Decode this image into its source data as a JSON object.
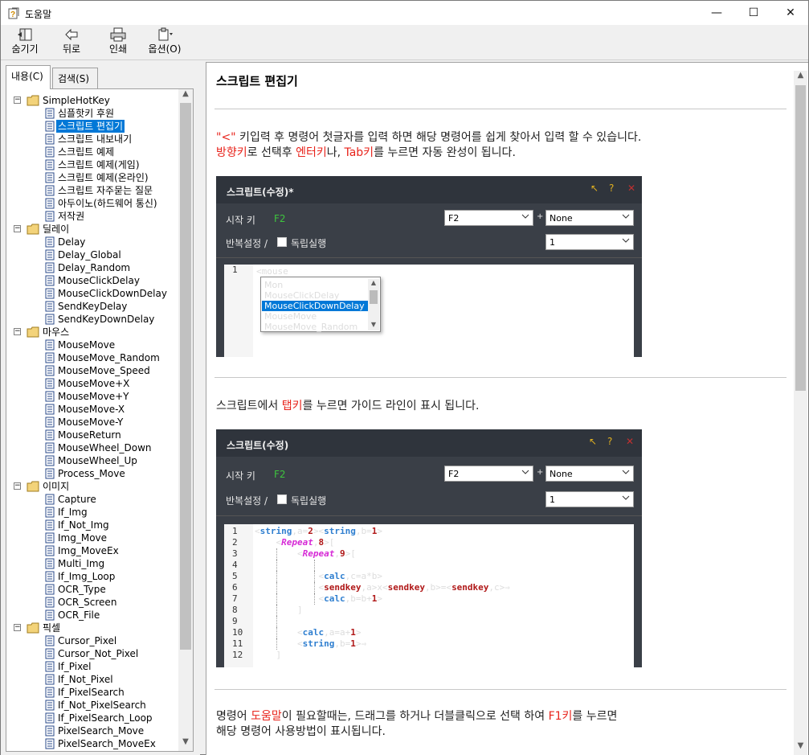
{
  "window": {
    "title": "도움말",
    "minimize": "—",
    "maximize": "☐",
    "close": "✕"
  },
  "toolbar": {
    "hide": "숨기기",
    "back": "뒤로",
    "print": "인쇄",
    "options": "옵션(O)"
  },
  "tabs": {
    "contents": "내용(C)",
    "search": "검색(S)"
  },
  "tree": [
    {
      "type": "folder",
      "level": 0,
      "label": "SimpleHotKey"
    },
    {
      "type": "page",
      "level": 1,
      "label": "심플핫키 후원"
    },
    {
      "type": "page",
      "level": 1,
      "label": "스크립트 편집기",
      "selected": true
    },
    {
      "type": "page",
      "level": 1,
      "label": "스크립트 내보내기"
    },
    {
      "type": "page",
      "level": 1,
      "label": "스크립트 예제"
    },
    {
      "type": "page",
      "level": 1,
      "label": "스크립트 예제(게임)"
    },
    {
      "type": "page",
      "level": 1,
      "label": "스크립트 예제(온라인)"
    },
    {
      "type": "page",
      "level": 1,
      "label": "스크립트 자주묻는 질문"
    },
    {
      "type": "page",
      "level": 1,
      "label": "아두이노(하드웨어 통신)"
    },
    {
      "type": "page",
      "level": 1,
      "label": "저작권"
    },
    {
      "type": "folder",
      "level": 0,
      "label": "딜레이"
    },
    {
      "type": "page",
      "level": 1,
      "label": "Delay"
    },
    {
      "type": "page",
      "level": 1,
      "label": "Delay_Global"
    },
    {
      "type": "page",
      "level": 1,
      "label": "Delay_Random"
    },
    {
      "type": "page",
      "level": 1,
      "label": "MouseClickDelay"
    },
    {
      "type": "page",
      "level": 1,
      "label": "MouseClickDownDelay"
    },
    {
      "type": "page",
      "level": 1,
      "label": "SendKeyDelay"
    },
    {
      "type": "page",
      "level": 1,
      "label": "SendKeyDownDelay"
    },
    {
      "type": "folder",
      "level": 0,
      "label": "마우스"
    },
    {
      "type": "page",
      "level": 1,
      "label": "MouseMove"
    },
    {
      "type": "page",
      "level": 1,
      "label": "MouseMove_Random"
    },
    {
      "type": "page",
      "level": 1,
      "label": "MouseMove_Speed"
    },
    {
      "type": "page",
      "level": 1,
      "label": "MouseMove+X"
    },
    {
      "type": "page",
      "level": 1,
      "label": "MouseMove+Y"
    },
    {
      "type": "page",
      "level": 1,
      "label": "MouseMove-X"
    },
    {
      "type": "page",
      "level": 1,
      "label": "MouseMove-Y"
    },
    {
      "type": "page",
      "level": 1,
      "label": "MouseReturn"
    },
    {
      "type": "page",
      "level": 1,
      "label": "MouseWheel_Down"
    },
    {
      "type": "page",
      "level": 1,
      "label": "MouseWheel_Up"
    },
    {
      "type": "page",
      "level": 1,
      "label": "Process_Move"
    },
    {
      "type": "folder",
      "level": 0,
      "label": "이미지"
    },
    {
      "type": "page",
      "level": 1,
      "label": "Capture"
    },
    {
      "type": "page",
      "level": 1,
      "label": "If_Img"
    },
    {
      "type": "page",
      "level": 1,
      "label": "If_Not_Img"
    },
    {
      "type": "page",
      "level": 1,
      "label": "Img_Move"
    },
    {
      "type": "page",
      "level": 1,
      "label": "Img_MoveEx"
    },
    {
      "type": "page",
      "level": 1,
      "label": "Multi_Img"
    },
    {
      "type": "page",
      "level": 1,
      "label": "If_Img_Loop"
    },
    {
      "type": "page",
      "level": 1,
      "label": "OCR_Type"
    },
    {
      "type": "page",
      "level": 1,
      "label": "OCR_Screen"
    },
    {
      "type": "page",
      "level": 1,
      "label": "OCR_File"
    },
    {
      "type": "folder",
      "level": 0,
      "label": "픽셀"
    },
    {
      "type": "page",
      "level": 1,
      "label": "Cursor_Pixel"
    },
    {
      "type": "page",
      "level": 1,
      "label": "Cursor_Not_Pixel"
    },
    {
      "type": "page",
      "level": 1,
      "label": "If_Pixel"
    },
    {
      "type": "page",
      "level": 1,
      "label": "If_Not_Pixel"
    },
    {
      "type": "page",
      "level": 1,
      "label": "If_PixelSearch"
    },
    {
      "type": "page",
      "level": 1,
      "label": "If_Not_PixelSearch"
    },
    {
      "type": "page",
      "level": 1,
      "label": "If_PixelSearch_Loop"
    },
    {
      "type": "page",
      "level": 1,
      "label": "PixelSearch_Move"
    },
    {
      "type": "page",
      "level": 1,
      "label": "PixelSearch_MoveEx"
    }
  ],
  "article": {
    "title": "스크립트 편집기",
    "p1a": "\"<\"",
    "p1b": " 키입력 후 명령어 첫글자를 입력 하면 해당 명령어를 쉽게 찾아서 입력 할 수 있습니다.",
    "p2a": "방향키",
    "p2b": "로 선택후 ",
    "p2c": "엔터키",
    "p2d": "나, ",
    "p2e": "Tab키",
    "p2f": "를 누르면 자동 완성이 됩니다.",
    "p3a": "스크립트에서 ",
    "p3b": "탭키",
    "p3c": "를 누르면 가이드 라인이 표시 됩니다.",
    "p4a": "명령어 ",
    "p4b": "도움말",
    "p4c": "이 필요할때는, 드래그를 하거나 더블클릭으로 선택 하여 ",
    "p4d": "F1키",
    "p4e": "를 누르면",
    "p5": "해당 명령어 사용방법이 표시됩니다."
  },
  "dialog1": {
    "title": "스크립트(수정)*",
    "start_key_label": "시작 키",
    "start_key_value": "F2",
    "key_select": "F2",
    "plus": "+",
    "mod_select": "None",
    "repeat_label": "반복설정 /",
    "independent_label": "독립실행",
    "repeat_select": "1",
    "line_no": "1",
    "code": "<mouse",
    "autocomplete": [
      "Mon",
      "MouseClickDelay",
      "MouseClickDownDelay",
      "MouseMove",
      "MouseMove_Random"
    ],
    "autocomplete_selected": "MouseClickDownDelay",
    "icons": [
      "arrow-icon",
      "help-icon",
      "close-icon"
    ]
  },
  "dialog2": {
    "title": "스크립트(수정)",
    "start_key_label": "시작 키",
    "start_key_value": "F2",
    "key_select": "F2",
    "plus": "+",
    "mod_select": "None",
    "repeat_label": "반복설정 /",
    "independent_label": "독립실행",
    "repeat_select": "1",
    "line_numbers": [
      "1",
      "2",
      "3",
      "4",
      "5",
      "6",
      "7",
      "8",
      "9",
      "10",
      "11",
      "12"
    ]
  },
  "colors": {
    "accent_red": "#e8231b",
    "dialog_bg": "#3a3f47",
    "selection": "#0078d7",
    "keyword_blue": "#2f7fd0",
    "keyword_magenta": "#d62ad6",
    "keyword_red": "#b01818"
  }
}
